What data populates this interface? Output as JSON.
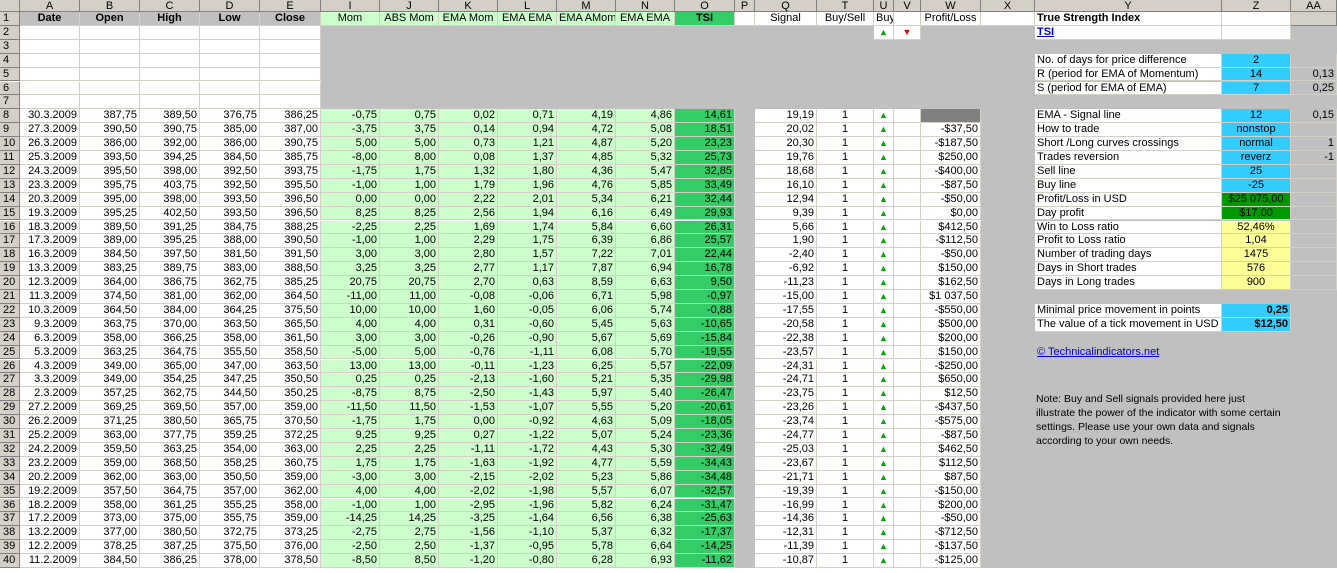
{
  "col_letters": [
    "A",
    "B",
    "C",
    "D",
    "E",
    "I",
    "J",
    "K",
    "L",
    "M",
    "N",
    "O",
    "P",
    "Q",
    "T",
    "U",
    "V",
    "W",
    "X",
    "Y",
    "Z",
    "AA"
  ],
  "headers": {
    "A": "Date",
    "B": "Open",
    "C": "High",
    "D": "Low",
    "E": "Close",
    "I": "Mom",
    "J": "ABS Mom",
    "K": "EMA Mom",
    "L": "EMA EMA",
    "M": "EMA AMom",
    "N": "EMA EMA",
    "O": "TSI",
    "Q": "Signal",
    "T": "Buy/Sell",
    "U": "Buy/Sell",
    "W": "Profit/Loss"
  },
  "icons": {
    "up": "up-triangle-icon",
    "down": "down-triangle-icon"
  },
  "colors": {
    "header_gray": "#d4d0c8",
    "green_cells": "#ccffcc",
    "tsi_green": "#33cc66",
    "cyan": "#33ccff",
    "yellow": "#ffff99",
    "profit_green": "#009900"
  },
  "rows": [
    {
      "n": "8",
      "date": "30.3.2009",
      "open": "387,75",
      "high": "389,50",
      "low": "376,75",
      "close": "386,25",
      "mom": "-0,75",
      "abs": "0,75",
      "emam": "0,02",
      "emae": "0,71",
      "emaa": "4,19",
      "emae2": "4,86",
      "tsi": "14,61",
      "sig": "19,19",
      "bs": "1",
      "pl": ""
    },
    {
      "n": "9",
      "date": "27.3.2009",
      "open": "390,50",
      "high": "390,75",
      "low": "385,00",
      "close": "387,00",
      "mom": "-3,75",
      "abs": "3,75",
      "emam": "0,14",
      "emae": "0,94",
      "emaa": "4,72",
      "emae2": "5,08",
      "tsi": "18,51",
      "sig": "20,02",
      "bs": "1",
      "pl": "-$37,50"
    },
    {
      "n": "10",
      "date": "26.3.2009",
      "open": "386,00",
      "high": "392,00",
      "low": "386,00",
      "close": "390,75",
      "mom": "5,00",
      "abs": "5,00",
      "emam": "0,73",
      "emae": "1,21",
      "emaa": "4,87",
      "emae2": "5,20",
      "tsi": "23,23",
      "sig": "20,30",
      "bs": "1",
      "pl": "-$187,50"
    },
    {
      "n": "11",
      "date": "25.3.2009",
      "open": "393,50",
      "high": "394,25",
      "low": "384,50",
      "close": "385,75",
      "mom": "-8,00",
      "abs": "8,00",
      "emam": "0,08",
      "emae": "1,37",
      "emaa": "4,85",
      "emae2": "5,32",
      "tsi": "25,73",
      "sig": "19,76",
      "bs": "1",
      "pl": "$250,00"
    },
    {
      "n": "12",
      "date": "24.3.2009",
      "open": "395,50",
      "high": "398,00",
      "low": "392,50",
      "close": "393,75",
      "mom": "-1,75",
      "abs": "1,75",
      "emam": "1,32",
      "emae": "1,80",
      "emaa": "4,36",
      "emae2": "5,47",
      "tsi": "32,85",
      "sig": "18,68",
      "bs": "1",
      "pl": "-$400,00"
    },
    {
      "n": "13",
      "date": "23.3.2009",
      "open": "395,75",
      "high": "403,75",
      "low": "392,50",
      "close": "395,50",
      "mom": "-1,00",
      "abs": "1,00",
      "emam": "1,79",
      "emae": "1,96",
      "emaa": "4,76",
      "emae2": "5,85",
      "tsi": "33,49",
      "sig": "16,10",
      "bs": "1",
      "pl": "-$87,50"
    },
    {
      "n": "14",
      "date": "20.3.2009",
      "open": "395,00",
      "high": "398,00",
      "low": "393,50",
      "close": "396,50",
      "mom": "0,00",
      "abs": "0,00",
      "emam": "2,22",
      "emae": "2,01",
      "emaa": "5,34",
      "emae2": "6,21",
      "tsi": "32,44",
      "sig": "12,94",
      "bs": "1",
      "pl": "-$50,00"
    },
    {
      "n": "15",
      "date": "19.3.2009",
      "open": "395,25",
      "high": "402,50",
      "low": "393,50",
      "close": "396,50",
      "mom": "8,25",
      "abs": "8,25",
      "emam": "2,56",
      "emae": "1,94",
      "emaa": "6,16",
      "emae2": "6,49",
      "tsi": "29,93",
      "sig": "9,39",
      "bs": "1",
      "pl": "$0,00"
    },
    {
      "n": "16",
      "date": "18.3.2009",
      "open": "389,50",
      "high": "391,25",
      "low": "384,75",
      "close": "388,25",
      "mom": "-2,25",
      "abs": "2,25",
      "emam": "1,69",
      "emae": "1,74",
      "emaa": "5,84",
      "emae2": "6,60",
      "tsi": "26,31",
      "sig": "5,66",
      "bs": "1",
      "pl": "$412,50"
    },
    {
      "n": "17",
      "date": "17.3.2009",
      "open": "389,00",
      "high": "395,25",
      "low": "388,00",
      "close": "390,50",
      "mom": "-1,00",
      "abs": "1,00",
      "emam": "2,29",
      "emae": "1,75",
      "emaa": "6,39",
      "emae2": "6,86",
      "tsi": "25,57",
      "sig": "1,90",
      "bs": "1",
      "pl": "-$112,50"
    },
    {
      "n": "18",
      "date": "16.3.2009",
      "open": "384,50",
      "high": "397,50",
      "low": "381,50",
      "close": "391,50",
      "mom": "3,00",
      "abs": "3,00",
      "emam": "2,80",
      "emae": "1,57",
      "emaa": "7,22",
      "emae2": "7,01",
      "tsi": "22,44",
      "sig": "-2,40",
      "bs": "1",
      "pl": "-$50,00"
    },
    {
      "n": "19",
      "date": "13.3.2009",
      "open": "383,25",
      "high": "389,75",
      "low": "383,00",
      "close": "388,50",
      "mom": "3,25",
      "abs": "3,25",
      "emam": "2,77",
      "emae": "1,17",
      "emaa": "7,87",
      "emae2": "6,94",
      "tsi": "16,78",
      "sig": "-6,92",
      "bs": "1",
      "pl": "$150,00"
    },
    {
      "n": "20",
      "date": "12.3.2009",
      "open": "364,00",
      "high": "386,75",
      "low": "362,75",
      "close": "385,25",
      "mom": "20,75",
      "abs": "20,75",
      "emam": "2,70",
      "emae": "0,63",
      "emaa": "8,59",
      "emae2": "6,63",
      "tsi": "9,50",
      "sig": "-11,23",
      "bs": "1",
      "pl": "$162,50"
    },
    {
      "n": "21",
      "date": "11.3.2009",
      "open": "374,50",
      "high": "381,00",
      "low": "362,00",
      "close": "364,50",
      "mom": "-11,00",
      "abs": "11,00",
      "emam": "-0,08",
      "emae": "-0,06",
      "emaa": "6,71",
      "emae2": "5,98",
      "tsi": "-0,97",
      "sig": "-15,00",
      "bs": "1",
      "pl": "$1 037,50"
    },
    {
      "n": "22",
      "date": "10.3.2009",
      "open": "364,50",
      "high": "384,00",
      "low": "364,25",
      "close": "375,50",
      "mom": "10,00",
      "abs": "10,00",
      "emam": "1,60",
      "emae": "-0,05",
      "emaa": "6,06",
      "emae2": "5,74",
      "tsi": "-0,88",
      "sig": "-17,55",
      "bs": "1",
      "pl": "-$550,00"
    },
    {
      "n": "23",
      "date": "9.3.2009",
      "open": "363,75",
      "high": "370,00",
      "low": "363,50",
      "close": "365,50",
      "mom": "4,00",
      "abs": "4,00",
      "emam": "0,31",
      "emae": "-0,60",
      "emaa": "5,45",
      "emae2": "5,63",
      "tsi": "-10,65",
      "sig": "-20,58",
      "bs": "1",
      "pl": "$500,00"
    },
    {
      "n": "24",
      "date": "6.3.2009",
      "open": "358,00",
      "high": "366,25",
      "low": "358,00",
      "close": "361,50",
      "mom": "3,00",
      "abs": "3,00",
      "emam": "-0,26",
      "emae": "-0,90",
      "emaa": "5,67",
      "emae2": "5,69",
      "tsi": "-15,84",
      "sig": "-22,38",
      "bs": "1",
      "pl": "$200,00"
    },
    {
      "n": "25",
      "date": "5.3.2009",
      "open": "363,25",
      "high": "364,75",
      "low": "355,50",
      "close": "358,50",
      "mom": "-5,00",
      "abs": "5,00",
      "emam": "-0,76",
      "emae": "-1,11",
      "emaa": "6,08",
      "emae2": "5,70",
      "tsi": "-19,55",
      "sig": "-23,57",
      "bs": "1",
      "pl": "$150,00"
    },
    {
      "n": "26",
      "date": "4.3.2009",
      "open": "349,00",
      "high": "365,00",
      "low": "347,00",
      "close": "363,50",
      "mom": "13,00",
      "abs": "13,00",
      "emam": "-0,11",
      "emae": "-1,23",
      "emaa": "6,25",
      "emae2": "5,57",
      "tsi": "-22,09",
      "sig": "-24,31",
      "bs": "1",
      "pl": "-$250,00"
    },
    {
      "n": "27",
      "date": "3.3.2009",
      "open": "349,00",
      "high": "354,25",
      "low": "347,25",
      "close": "350,50",
      "mom": "0,25",
      "abs": "0,25",
      "emam": "-2,13",
      "emae": "-1,60",
      "emaa": "5,21",
      "emae2": "5,35",
      "tsi": "-29,98",
      "sig": "-24,71",
      "bs": "1",
      "pl": "$650,00"
    },
    {
      "n": "28",
      "date": "2.3.2009",
      "open": "357,25",
      "high": "362,75",
      "low": "344,50",
      "close": "350,25",
      "mom": "-8,75",
      "abs": "8,75",
      "emam": "-2,50",
      "emae": "-1,43",
      "emaa": "5,97",
      "emae2": "5,40",
      "tsi": "-26,47",
      "sig": "-23,75",
      "bs": "1",
      "pl": "$12,50"
    },
    {
      "n": "29",
      "date": "27.2.2009",
      "open": "369,25",
      "high": "369,50",
      "low": "357,00",
      "close": "359,00",
      "mom": "-11,50",
      "abs": "11,50",
      "emam": "-1,53",
      "emae": "-1,07",
      "emaa": "5,55",
      "emae2": "5,20",
      "tsi": "-20,61",
      "sig": "-23,26",
      "bs": "1",
      "pl": "-$437,50"
    },
    {
      "n": "30",
      "date": "26.2.2009",
      "open": "371,25",
      "high": "380,50",
      "low": "365,75",
      "close": "370,50",
      "mom": "-1,75",
      "abs": "1,75",
      "emam": "0,00",
      "emae": "-0,92",
      "emaa": "4,63",
      "emae2": "5,09",
      "tsi": "-18,05",
      "sig": "-23,74",
      "bs": "1",
      "pl": "-$575,00"
    },
    {
      "n": "31",
      "date": "25.2.2009",
      "open": "363,00",
      "high": "377,75",
      "low": "359,25",
      "close": "372,25",
      "mom": "9,25",
      "abs": "9,25",
      "emam": "0,27",
      "emae": "-1,22",
      "emaa": "5,07",
      "emae2": "5,24",
      "tsi": "-23,36",
      "sig": "-24,77",
      "bs": "1",
      "pl": "-$87,50"
    },
    {
      "n": "32",
      "date": "24.2.2009",
      "open": "359,50",
      "high": "363,25",
      "low": "354,00",
      "close": "363,00",
      "mom": "2,25",
      "abs": "2,25",
      "emam": "-1,11",
      "emae": "-1,72",
      "emaa": "4,43",
      "emae2": "5,30",
      "tsi": "-32,49",
      "sig": "-25,03",
      "bs": "1",
      "pl": "$462,50"
    },
    {
      "n": "33",
      "date": "23.2.2009",
      "open": "359,00",
      "high": "368,50",
      "low": "358,25",
      "close": "360,75",
      "mom": "1,75",
      "abs": "1,75",
      "emam": "-1,63",
      "emae": "-1,92",
      "emaa": "4,77",
      "emae2": "5,59",
      "tsi": "-34,43",
      "sig": "-23,67",
      "bs": "1",
      "pl": "$112,50"
    },
    {
      "n": "34",
      "date": "20.2.2009",
      "open": "362,00",
      "high": "363,00",
      "low": "350,50",
      "close": "359,00",
      "mom": "-3,00",
      "abs": "3,00",
      "emam": "-2,15",
      "emae": "-2,02",
      "emaa": "5,23",
      "emae2": "5,86",
      "tsi": "-34,48",
      "sig": "-21,71",
      "bs": "1",
      "pl": "$87,50"
    },
    {
      "n": "35",
      "date": "19.2.2009",
      "open": "357,50",
      "high": "364,75",
      "low": "357,00",
      "close": "362,00",
      "mom": "4,00",
      "abs": "4,00",
      "emam": "-2,02",
      "emae": "-1,98",
      "emaa": "5,57",
      "emae2": "6,07",
      "tsi": "-32,57",
      "sig": "-19,39",
      "bs": "1",
      "pl": "-$150,00"
    },
    {
      "n": "36",
      "date": "18.2.2009",
      "open": "358,00",
      "high": "361,25",
      "low": "355,25",
      "close": "358,00",
      "mom": "-1,00",
      "abs": "1,00",
      "emam": "-2,95",
      "emae": "-1,96",
      "emaa": "5,82",
      "emae2": "6,24",
      "tsi": "-31,47",
      "sig": "-16,99",
      "bs": "1",
      "pl": "$200,00"
    },
    {
      "n": "37",
      "date": "17.2.2009",
      "open": "373,00",
      "high": "375,00",
      "low": "355,75",
      "close": "359,00",
      "mom": "-14,25",
      "abs": "14,25",
      "emam": "-3,25",
      "emae": "-1,64",
      "emaa": "6,56",
      "emae2": "6,38",
      "tsi": "-25,63",
      "sig": "-14,36",
      "bs": "1",
      "pl": "-$50,00"
    },
    {
      "n": "38",
      "date": "13.2.2009",
      "open": "377,00",
      "high": "380,50",
      "low": "372,75",
      "close": "373,25",
      "mom": "-2,75",
      "abs": "2,75",
      "emam": "-1,56",
      "emae": "-1,10",
      "emaa": "5,37",
      "emae2": "6,32",
      "tsi": "-17,37",
      "sig": "-12,31",
      "bs": "1",
      "pl": "-$712,50"
    },
    {
      "n": "39",
      "date": "12.2.2009",
      "open": "378,25",
      "high": "387,25",
      "low": "375,50",
      "close": "376,00",
      "mom": "-2,50",
      "abs": "2,50",
      "emam": "-1,37",
      "emae": "-0,95",
      "emaa": "5,78",
      "emae2": "6,64",
      "tsi": "-14,25",
      "sig": "-11,39",
      "bs": "1",
      "pl": "-$137,50"
    },
    {
      "n": "40",
      "date": "11.2.2009",
      "open": "384,50",
      "high": "386,25",
      "low": "378,00",
      "close": "378,50",
      "mom": "-8,50",
      "abs": "8,50",
      "emam": "-1,20",
      "emae": "-0,80",
      "emaa": "6,28",
      "emae2": "6,93",
      "tsi": "-11,62",
      "sig": "-10,87",
      "bs": "1",
      "pl": "-$125,00"
    }
  ],
  "panel": {
    "title": "True Strength Index",
    "tsi_link": "TSI",
    "params": [
      {
        "label": "No. of days for price difference",
        "value": "2",
        "aa": ""
      },
      {
        "label": "R (period for EMA of Momentum)",
        "value": "14",
        "aa": "0,13"
      },
      {
        "label": "S (period for EMA of EMA)",
        "value": "7",
        "aa": "0,25"
      }
    ],
    "settings": [
      {
        "label": "EMA - Signal line",
        "value": "12",
        "aa": "0,15",
        "cls": "cyan"
      },
      {
        "label": "How to trade",
        "value": "nonstop",
        "aa": "",
        "cls": "cyan"
      },
      {
        "label": "Short /Long curves crossings",
        "value": "normal",
        "aa": "1",
        "cls": "cyan"
      },
      {
        "label": "Trades reversion",
        "value": "reverz",
        "aa": "-1",
        "cls": "cyan"
      },
      {
        "label": "Sell line",
        "value": "25",
        "aa": "",
        "cls": "cyan"
      },
      {
        "label": "Buy line",
        "value": "-25",
        "aa": "",
        "cls": "cyan"
      },
      {
        "label": "Profit/Loss in USD",
        "value": "$25 075,00",
        "aa": "",
        "cls": "dg"
      },
      {
        "label": "Day profit",
        "value": "$17,00",
        "aa": "",
        "cls": "dg"
      },
      {
        "label": "Win to Loss ratio",
        "value": "52,46%",
        "aa": "",
        "cls": "yel"
      },
      {
        "label": "Profit to Loss ratio",
        "value": "1,04",
        "aa": "",
        "cls": "yel"
      },
      {
        "label": "Number of trading days",
        "value": "1475",
        "aa": "",
        "cls": "yel"
      },
      {
        "label": "Days in Short trades",
        "value": "576",
        "aa": "",
        "cls": "yel"
      },
      {
        "label": "Days in Long trades",
        "value": "900",
        "aa": "",
        "cls": "yel"
      }
    ],
    "tick": [
      {
        "label": "Minimal price movement in points",
        "value": "0,25"
      },
      {
        "label": "The value of a tick movement in USD",
        "value": "$12,50"
      }
    ],
    "website": "© Technicalindicators.net",
    "note": "Note: Buy and Sell signals provided here just illustrate the power of the indicator with some certain settings. Please use your own data and signals according to your own needs."
  }
}
